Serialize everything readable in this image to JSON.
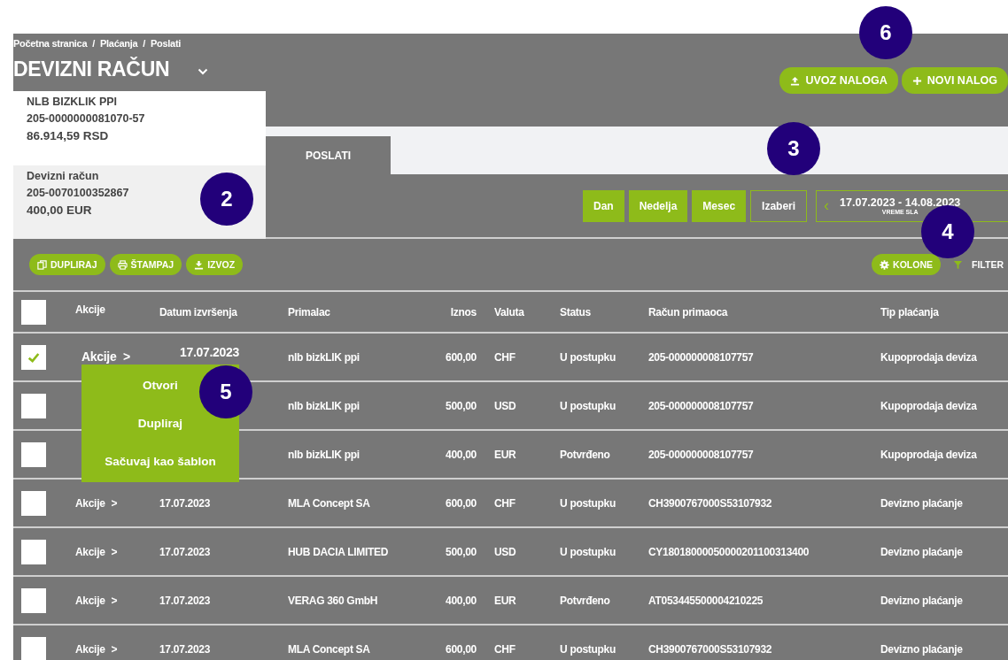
{
  "breadcrumb": [
    "Početna stranica",
    "Plaćanja",
    "Poslati"
  ],
  "breadcrumb_separator": "/",
  "title": "DEVIZNI RAČUN",
  "header_buttons": [
    {
      "label": "UVOZ NALOGA"
    },
    {
      "label": "NOVI NALOG"
    }
  ],
  "account_dropdown": [
    {
      "name": "NLB BIZKLIK PPI",
      "number": "205-0000000081070-57",
      "balance": "86.914,59 RSD",
      "selected": false
    },
    {
      "name": "Devizni račun",
      "number": "205-0070100352867",
      "balance": "400,00 EUR",
      "selected": true
    }
  ],
  "tabs": [
    {
      "label": "POSLATI"
    }
  ],
  "period_buttons": [
    {
      "label": "Dan",
      "kind": "preset"
    },
    {
      "label": "Nedelja",
      "kind": "preset"
    },
    {
      "label": "Mesec",
      "kind": "preset"
    },
    {
      "label": "Izaberi",
      "kind": "custom"
    }
  ],
  "date_range": {
    "prev": "‹",
    "range": "17.07.2023 - 14.08.2023",
    "caption": "VREME SLA"
  },
  "toolbar_left": [
    {
      "label": "DUPLIRAJ"
    },
    {
      "label": "ŠTAMPAJ"
    },
    {
      "label": "IZVOZ"
    }
  ],
  "toolbar_right": [
    {
      "label": "KOLONE",
      "kind": "pill"
    },
    {
      "label": "FILTER",
      "kind": "link"
    }
  ],
  "table": {
    "columns": [
      "Akcije",
      "Datum izvršenja",
      "Primalac",
      "Iznos",
      "Valuta",
      "Status",
      "Račun primaoca",
      "Tip plaćanja"
    ],
    "header_checked": false,
    "rows": [
      {
        "checked": true,
        "hovered": true,
        "actions": "Akcije",
        "arrow": ">",
        "date": "17.07.2023",
        "recipient": "nlb bizkLIK ppi",
        "amount": "600,00",
        "currency": "CHF",
        "status": "U postupku",
        "account": "205-000000008107757",
        "type": "Kupoprodaja deviza"
      },
      {
        "checked": false,
        "recipient": "nlb bizkLIK ppi",
        "amount": "500,00",
        "currency": "USD",
        "status": "U postupku",
        "account": "205-000000008107757",
        "type": "Kupoprodaja deviza"
      },
      {
        "checked": false,
        "recipient": "nlb bizkLIK ppi",
        "amount": "400,00",
        "currency": "EUR",
        "status": "Potvrđeno",
        "account": "205-000000008107757",
        "type": "Kupoprodaja deviza"
      },
      {
        "checked": false,
        "hovered": false,
        "actions": "Akcije",
        "arrow": ">",
        "date": "17.07.2023",
        "recipient": "MLA Concept SA",
        "amount": "600,00",
        "currency": "CHF",
        "status": "U postupku",
        "account": "CH3900767000S53107932",
        "type": "Devizno plaćanje"
      },
      {
        "checked": false,
        "hovered": false,
        "actions": "Akcije",
        "arrow": ">",
        "date": "17.07.2023",
        "recipient": "HUB DACIA LIMITED",
        "amount": "500,00",
        "currency": "USD",
        "status": "U postupku",
        "account": "CY18018000050000201100313400",
        "type": "Devizno plaćanje"
      },
      {
        "checked": false,
        "hovered": false,
        "actions": "Akcije",
        "arrow": ">",
        "date": "17.07.2023",
        "recipient": "VERAG 360 GmbH",
        "amount": "400,00",
        "currency": "EUR",
        "status": "Potvrđeno",
        "account": "AT053445500004210225",
        "type": "Devizno plaćanje"
      },
      {
        "checked": false,
        "hovered": false,
        "actions": "Akcije",
        "arrow": ">",
        "date": "17.07.2023",
        "recipient": "MLA Concept SA",
        "amount": "600,00",
        "currency": "CHF",
        "status": "U postupku",
        "account": "CH3900767000S53107932",
        "type": "Devizno plaćanje"
      }
    ]
  },
  "actions_menu": [
    "Otvori",
    "Dupliraj",
    "Sačuvaj kao šablon"
  ],
  "callouts": [
    "6",
    "3",
    "2",
    "4",
    "5"
  ]
}
